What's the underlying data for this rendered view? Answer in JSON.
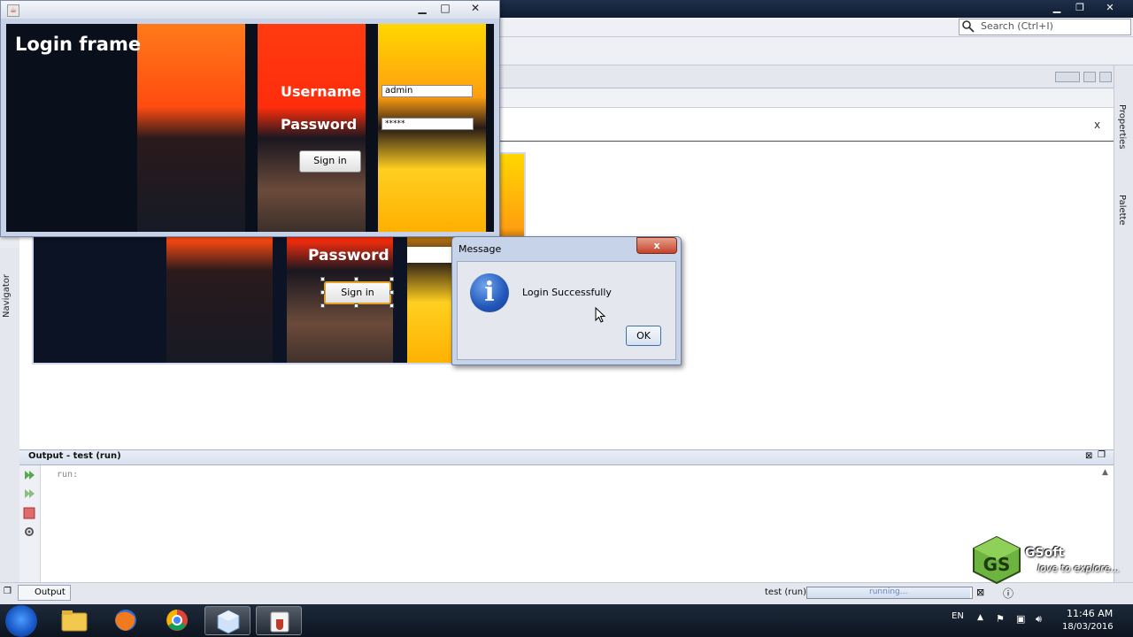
{
  "ide": {
    "search_placeholder": "Search (Ctrl+I)",
    "inner_close": "x",
    "navigator_label": "Navigator",
    "properties_label": "Properties",
    "palette_label": "Palette"
  },
  "login_frame": {
    "title": "Login frame",
    "username_label": "Username",
    "password_label": "Password",
    "username_value": "admin",
    "password_value": "*****",
    "signin_label": "Sign in"
  },
  "design_preview": {
    "password_label": "Password",
    "signin_label": "Sign in"
  },
  "message_dialog": {
    "title": "Message",
    "text": "Login Successfully",
    "ok_label": "OK",
    "close_label": "x"
  },
  "output": {
    "title": "Output - test (run)",
    "text": "run:",
    "tab_label": "Output"
  },
  "status": {
    "task": "test (run)",
    "progress_text": "running..."
  },
  "watermark": {
    "name": "GSoft",
    "tagline": "love to explore..."
  },
  "taskbar": {
    "lang": "EN",
    "time": "11:46 AM",
    "date": "18/03/2016"
  },
  "colors": {
    "accent_orange": "#e1a227",
    "dialog_close_red": "#c4432a",
    "info_blue": "#2256b8"
  }
}
